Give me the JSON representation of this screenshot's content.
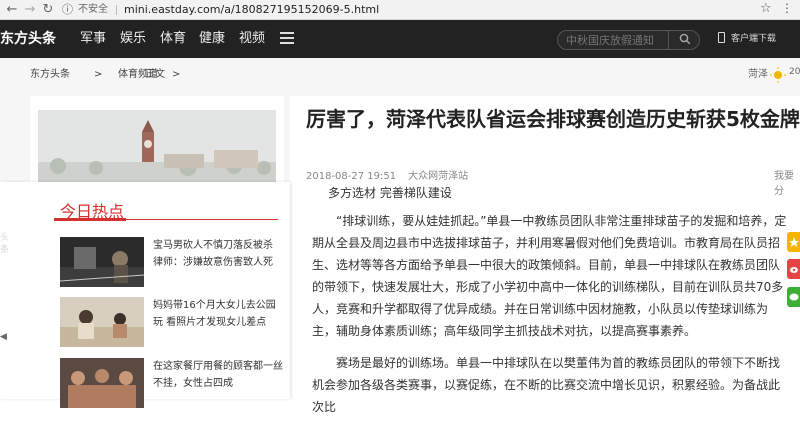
{
  "browser": {
    "insecure_label": "不安全",
    "url": "mini.eastday.com/a/180827195152069-5.html"
  },
  "site": {
    "logo": "东方头条",
    "nav": [
      "军事",
      "娱乐",
      "体育",
      "健康",
      "视频"
    ],
    "search_placeholder": "中秋国庆放假通知",
    "client_download": "客户端下载"
  },
  "breadcrumb": [
    "东方头条",
    ">",
    "体育频道",
    ">",
    "正文"
  ],
  "weather": {
    "city": "菏泽",
    "temp": "20"
  },
  "article": {
    "title": "厉害了，菏泽代表队省运会排球赛创造历史斩获5枚金牌",
    "date": "2018-08-27 19:51",
    "source": "大众网菏泽站",
    "share_label": "我要分",
    "paragraphs": [
      "多方选材 完善梯队建设",
      "“排球训练，要从娃娃抓起。”单县一中教练员团队非常注重排球苗子的发掘和培养，定期从全县及周边县市中选拔排球苗子，并利用寒暑假对他们免费培训。市教育局在队员招生、选材等等各方面给予单县一中很大的政策倾斜。目前，单县一中排球队在教练员团队的带领下，快速发展壮大，形成了小学初中高中一体化的训练梯队，目前在训队员共70多人，竞赛和升学都取得了优异成绩。并在日常训练中因材施教，小队员以传垫球训练为主，辅助身体素质训练；高年级同学主抓技战术对抗，以提高赛事素养。",
      "赛场是最好的训练场。单县一中排球队在以樊董伟为首的教练员团队的带领下不断找机会参加各级各类赛事，以赛促练，在不断的比赛交流中增长见识，积累经验。为备战此次比"
    ]
  },
  "hot": {
    "title": "今日热点",
    "items": [
      {
        "text": "宝马男砍人不慎刀落反被杀 律师：涉嫌故意伤害致人死"
      },
      {
        "text": "妈妈带16个月大女儿去公园玩 看照片才发现女儿差点"
      },
      {
        "text": "在这家餐厅用餐的顾客都一丝不挂，女性占四成"
      }
    ]
  },
  "side_tab": "头条",
  "colors": {
    "accent_red": "#d43030",
    "nav_bg": "#222222",
    "share_yellow": "#f5b400",
    "share_red": "#e64343",
    "share_green": "#3cb034"
  }
}
